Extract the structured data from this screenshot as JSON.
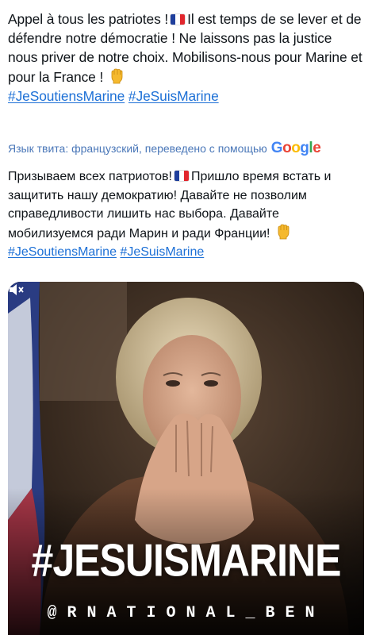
{
  "tweet": {
    "line1_before_flag": "Appel à tous les patriotes !",
    "line1_after_flag": "Il est temps de se lever et de défendre notre démocratie ! Ne laissons pas la justice nous priver de notre choix. Mobilisons-nous pour Marine et pour la France !",
    "hashtag1": "#JeSoutiensMarine",
    "hashtag2": "#JeSuisMarine"
  },
  "translation": {
    "label": "Язык твита: французский, переведено с помощью",
    "provider": "Google"
  },
  "translated": {
    "before_flag": "Призываем всех патриотов!",
    "after_flag": "Пришло время встать и защитить нашу демократию! Давайте не позволим справедливости лишить нас выбора. Давайте мобилизуемся ради Марин и ради Франции!",
    "hashtag1": "#JeSoutiensMarine",
    "hashtag2": "#JeSuisMarine"
  },
  "media": {
    "banner_text": "#JESUISMARINE",
    "handle_text": "@RNATIONAL_BEN",
    "icons": [
      "flag-fr-icon",
      "raised-fist-icon",
      "mute-icon"
    ]
  },
  "colors": {
    "hashtag": "#1d70d6",
    "translate_label": "#4a77b8",
    "media_background": "#2a1d14"
  }
}
